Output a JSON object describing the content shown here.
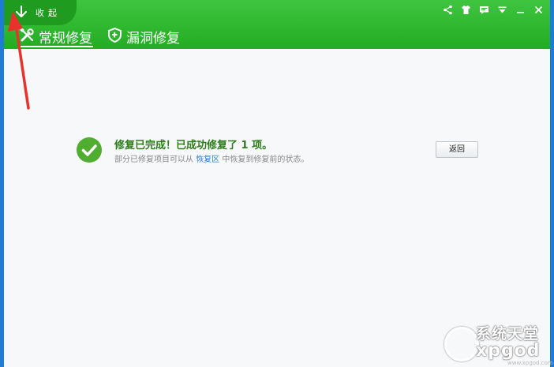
{
  "window": {
    "collapse_label": "收起",
    "controls": [
      "share-icon",
      "skin-icon",
      "feedback-icon",
      "menu-icon",
      "minimize-icon",
      "close-icon"
    ]
  },
  "tabs": [
    {
      "label": "常规修复",
      "icon": "wrench-screwdriver-icon",
      "active": true
    },
    {
      "label": "漏洞修复",
      "icon": "shield-patch-icon",
      "active": false
    }
  ],
  "result": {
    "title": "修复已完成！已成功修复了 1 项。",
    "sub_prefix": "部分已修复项目可以从",
    "sub_link": "恢复区",
    "sub_suffix": "中恢复到修复前的状态。",
    "back_label": "返回"
  },
  "watermark": {
    "line1": "系统天堂",
    "line2": "xpgod",
    "line3": "www.xpgod.com"
  },
  "colors": {
    "brand_green": "#2db32d",
    "success_green": "#4fae2f",
    "link_blue": "#2a7bd1",
    "annotation_red": "#e8322b",
    "outer_frame": "#1e7bd6"
  }
}
